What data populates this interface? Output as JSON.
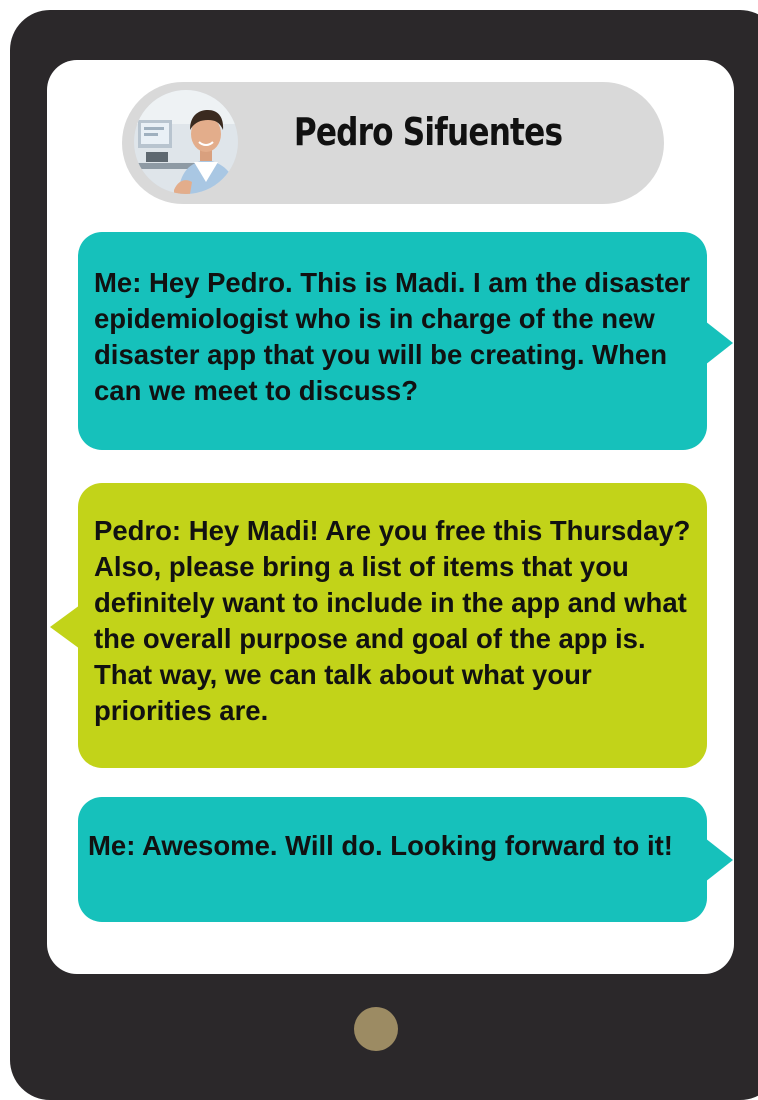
{
  "contact": {
    "name": "Pedro Sifuentes"
  },
  "messages": [
    {
      "sender": "me",
      "text": "Me: Hey Pedro. This is Madi. I am the disaster epidemiologist who is in charge of the new disaster app that you will be creating. When can we meet to discuss?"
    },
    {
      "sender": "contact",
      "text": "Pedro: Hey Madi! Are you free this Thursday? Also, please bring a list of items that you definitely want to include in the app and what the overall purpose and goal of the app is. That way, we can talk about what your priorities are."
    },
    {
      "sender": "me",
      "text": "Me: Awesome. Will do. Looking forward to it!"
    }
  ],
  "colors": {
    "device": "#2b282a",
    "screen": "#ffffff",
    "header": "#d9d9d9",
    "outgoing_bubble": "#16c1bb",
    "incoming_bubble": "#c2d319",
    "home_button": "#9c8b63"
  },
  "icons": {
    "avatar": "contact-photo-avatar",
    "home": "home-button-circle"
  }
}
